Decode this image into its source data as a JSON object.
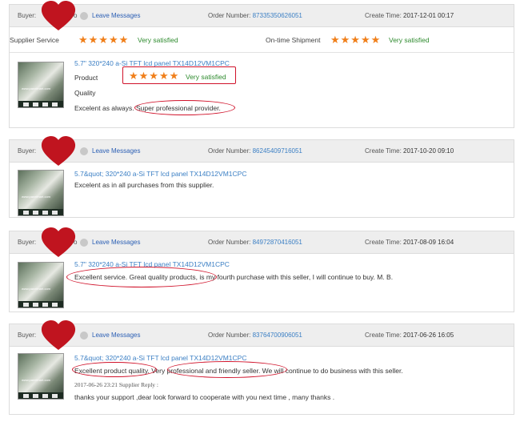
{
  "colors": {
    "accent": "#d0122a",
    "link": "#3b7fc4",
    "stars": "#f07f1a",
    "satisfied": "#2e8b2e"
  },
  "labels": {
    "buyer": "Buyer:",
    "leave_messages": "Leave Messages",
    "order_number": "Order Number:",
    "create_time": "Create Time:"
  },
  "reviews": [
    {
      "buyer_suffix": "o",
      "order_number": "87335350626051",
      "create_time": "2017-12-01 00:17",
      "supplier_service_label": "Supplier Service",
      "supplier_service_stars": "★★★★★",
      "supplier_service_text": "Very satisfied",
      "shipment_label": "On-time Shipment",
      "shipment_stars": "★★★★★",
      "shipment_text": "Very satisfied",
      "product_title": "5.7\" 320*240 a-Si TFT lcd panel TX14D12VM1CPC",
      "product_label": "Product",
      "product_stars": "★★★★★",
      "product_text": "Very satisfied",
      "quality_label": "Quality",
      "comment": "Excelent as always. Super professional provider."
    },
    {
      "buyer_suffix": "",
      "order_number": "86245409716051",
      "create_time": "2017-10-20 09:10",
      "product_title": "5.7&quot; 320*240 a-Si TFT lcd panel TX14D12VM1CPC",
      "comment": "Excelent as in all purchases from this supplier."
    },
    {
      "buyer_suffix": "o",
      "order_number": "84972870416051",
      "create_time": "2017-08-09 16:04",
      "product_title": "5.7\" 320*240 a-Si TFT lcd panel TX14D12VM1CPC",
      "comment": "Excellent service. Great quality products, is my fourth purchase with this seller, I will continue to buy. M. B."
    },
    {
      "buyer_suffix": "",
      "order_number": "83764700906051",
      "create_time": "2017-06-26 16:05",
      "product_title": "5.7&quot; 320*240 a-Si TFT lcd panel TX14D12VM1CPC",
      "comment": "Excellent product quality. Very professional and friendly seller. We will continue to do business with this seller.",
      "reply_time": "2017-06-26 23:21  Supplier Reply :",
      "reply_text": "thanks your support ,dear look forward to cooperate with you next time , many thanks ."
    }
  ]
}
